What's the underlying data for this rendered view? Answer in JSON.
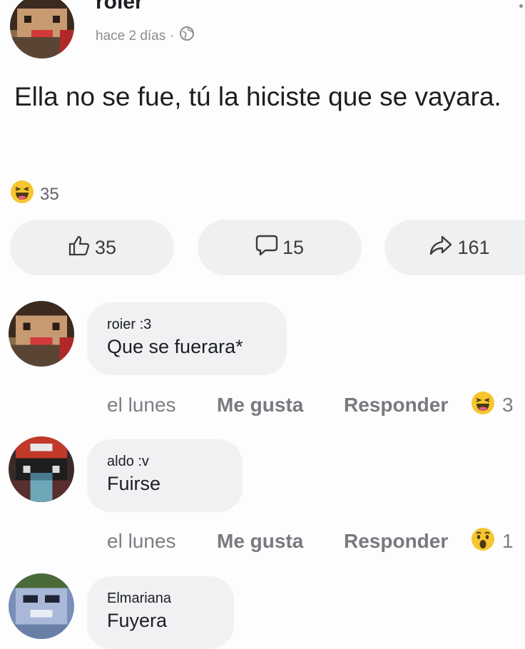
{
  "post": {
    "author": "roier",
    "time": "hace 2 días",
    "separator": "·",
    "text": "Ella no se fue, tú la hiciste que se vayara.",
    "reaction_count": "35",
    "actions": {
      "like_count": "35",
      "comment_count": "15",
      "share_count": "161"
    }
  },
  "comments": [
    {
      "author": "roier :3",
      "text": "Que se fuerara*",
      "time": "el lunes",
      "like_label": "Me gusta",
      "reply_label": "Responder",
      "reaction_count": "3",
      "reaction_icon": "laughing-emoji-icon"
    },
    {
      "author": "aldo :v",
      "text": "Fuirse",
      "time": "el lunes",
      "like_label": "Me gusta",
      "reply_label": "Responder",
      "reaction_count": "1",
      "reaction_icon": "wow-emoji-icon"
    },
    {
      "author": "Elmariana",
      "text": "Fuyera"
    }
  ],
  "colors": {
    "background": "#fdfdfd",
    "bubble": "#f0f1f3",
    "muted_text": "#7b7e83",
    "reaction_yellow": "#f7c530"
  }
}
